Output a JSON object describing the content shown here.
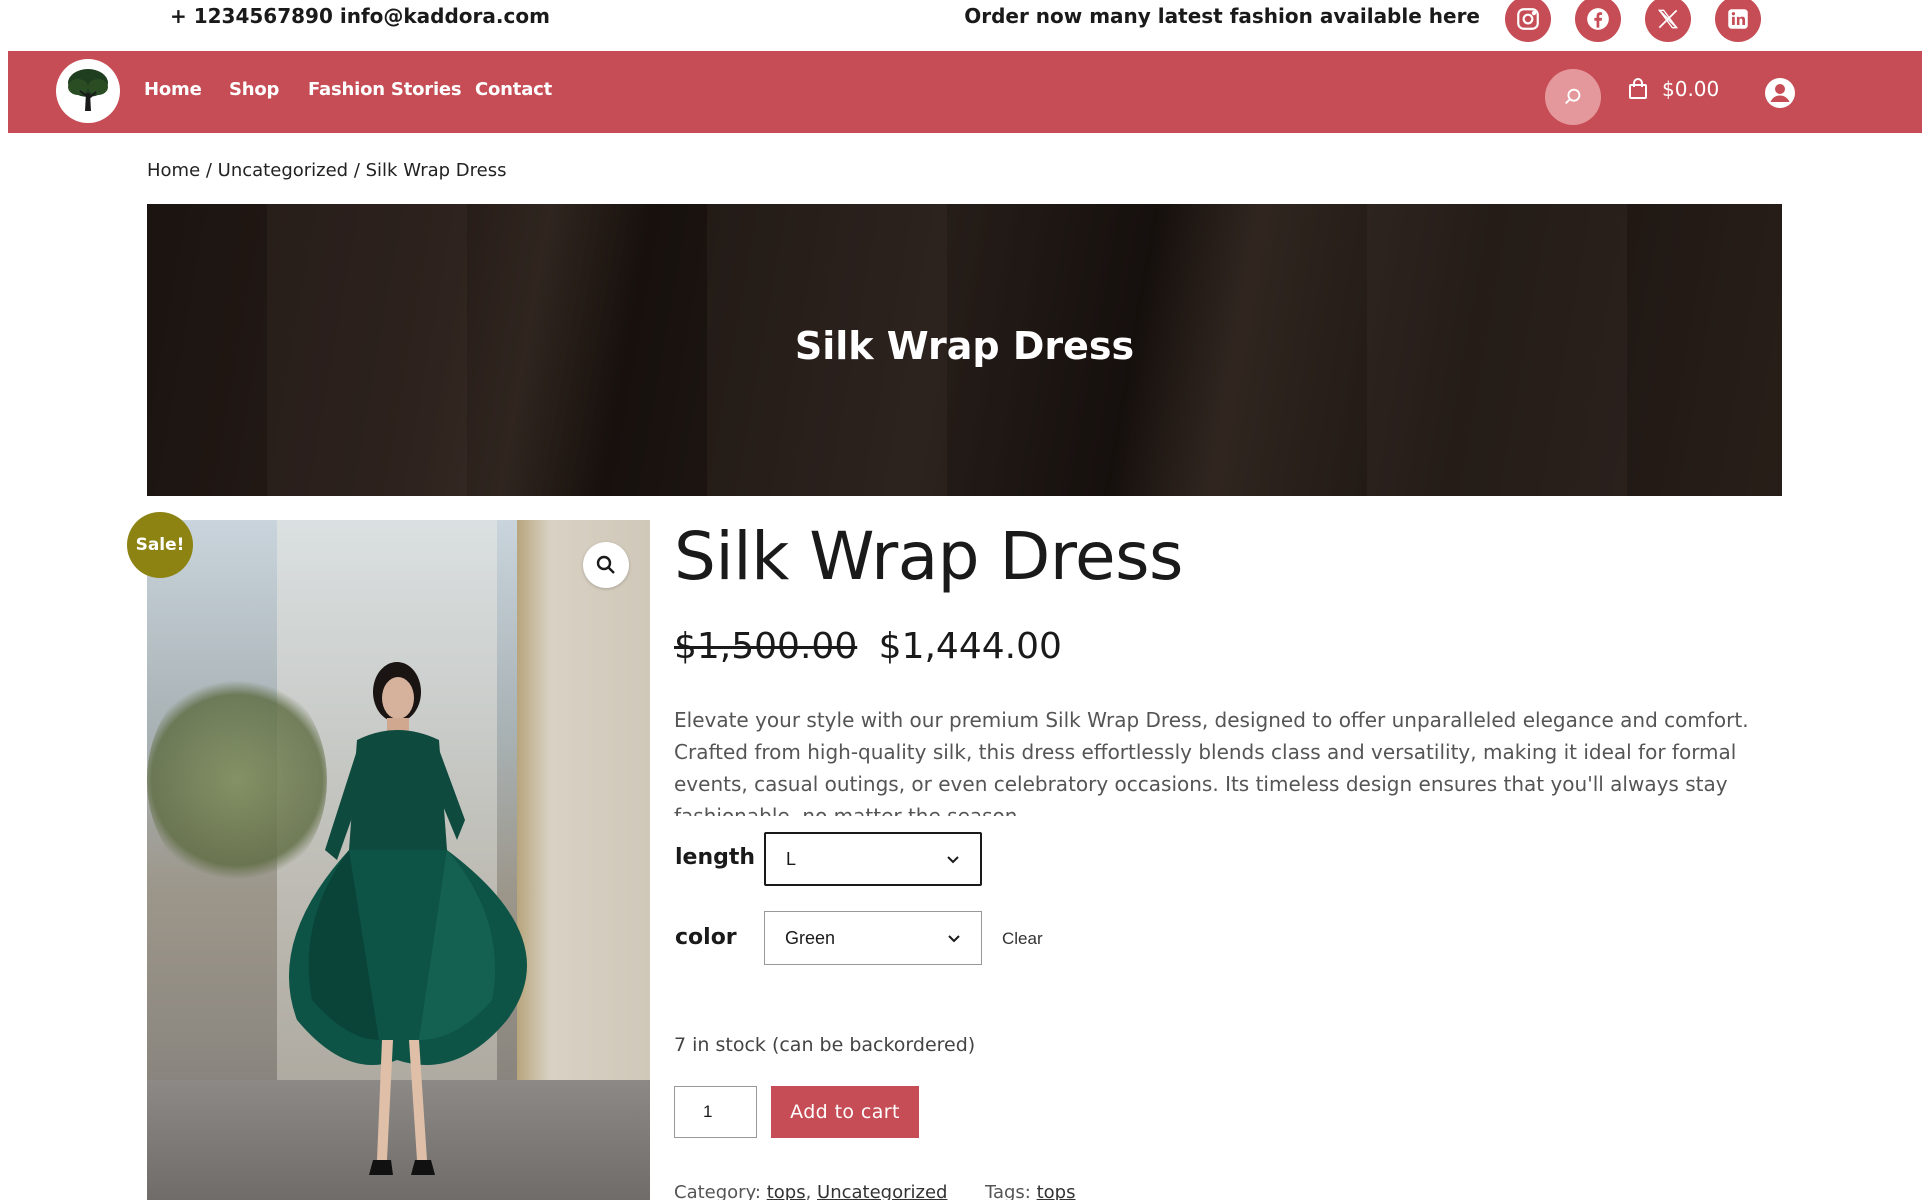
{
  "topbar": {
    "contact": "+ 1234567890 info@kaddora.com",
    "promo": "Order now many latest fashion available here",
    "social": [
      "instagram-icon",
      "facebook-icon",
      "x-icon",
      "linkedin-icon"
    ]
  },
  "nav": {
    "items": [
      {
        "label": "Home"
      },
      {
        "label": "Shop"
      },
      {
        "label": "Fashion Stories"
      },
      {
        "label": "Contact"
      }
    ],
    "cart_total": "$0.00"
  },
  "breadcrumb": {
    "home": "Home",
    "category": "Uncategorized",
    "current": "Silk Wrap Dress",
    "separator": " / "
  },
  "hero": {
    "title": "Silk Wrap Dress"
  },
  "product": {
    "badge": "Sale!",
    "title": "Silk Wrap Dress",
    "old_price": "$1,500.00",
    "price": "$1,444.00",
    "description": "Elevate your style with our premium Silk Wrap Dress, designed to offer unparalleled elegance and comfort. Crafted from high-quality silk, this dress effortlessly blends class and versatility, making it ideal for formal events, casual outings, or even celebratory occasions. Its timeless design ensures that you'll always stay fashionable, no matter the season.",
    "attributes": {
      "length_label": "length",
      "length_value": "L",
      "color_label": "color",
      "color_value": "Green",
      "clear_label": "Clear"
    },
    "stock": "7 in stock (can be backordered)",
    "quantity": "1",
    "add_to_cart": "Add to cart",
    "meta": {
      "category_label": "Category: ",
      "category_1": "tops",
      "category_sep": ", ",
      "category_2": "Uncategorized",
      "tags_label": "Tags: ",
      "tag_1": "tops"
    }
  },
  "colors": {
    "brand": "#c64d55",
    "sale_badge": "#8c8313"
  }
}
